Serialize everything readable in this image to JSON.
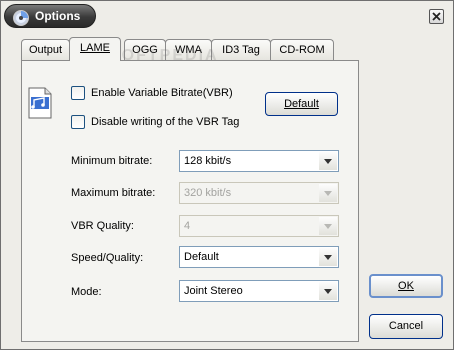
{
  "window": {
    "title": "Options"
  },
  "watermark": "SOFTPEDIA",
  "tabs": [
    {
      "label": "Output"
    },
    {
      "label": "LAME"
    },
    {
      "label": "OGG"
    },
    {
      "label": "WMA"
    },
    {
      "label": "ID3 Tag"
    },
    {
      "label": "CD-ROM"
    }
  ],
  "lame": {
    "vbr_checkbox_label": "Enable Variable Bitrate(VBR)",
    "vbr_tag_checkbox_label": "Disable writing of the VBR Tag",
    "default_button": "Default",
    "fields": [
      {
        "label": "Minimum bitrate:",
        "value": "128 kbit/s",
        "enabled": true
      },
      {
        "label": "Maximum bitrate:",
        "value": "320 kbit/s",
        "enabled": false
      },
      {
        "label": "VBR Quality:",
        "value": "4",
        "enabled": false
      },
      {
        "label": "Speed/Quality:",
        "value": "Default",
        "enabled": true
      },
      {
        "label": "Mode:",
        "value": "Joint Stereo",
        "enabled": true
      }
    ]
  },
  "buttons": {
    "ok": "OK",
    "cancel": "Cancel"
  }
}
